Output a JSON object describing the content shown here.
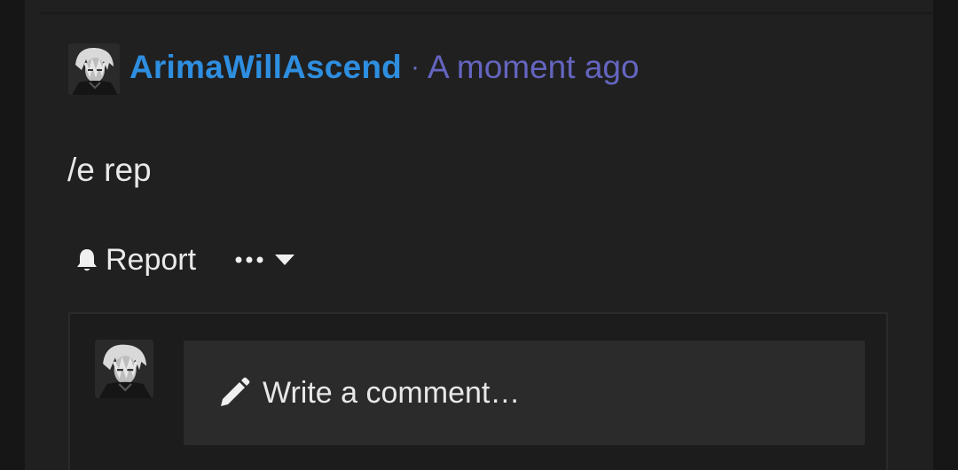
{
  "post": {
    "author": "ArimaWillAscend",
    "separator": "·",
    "timestamp": "A moment ago",
    "body": "/e rep",
    "avatar_icon": "user-avatar"
  },
  "actions": {
    "report_label": "Report",
    "report_icon": "bell-icon",
    "more_icon": "ellipsis-icon",
    "more_caret_icon": "caret-down-icon"
  },
  "comment_box": {
    "placeholder": "Write a comment…",
    "icon": "pencil-icon",
    "avatar_icon": "user-avatar"
  },
  "colors": {
    "background": "#161616",
    "card": "#202020",
    "username": "#2e8ee0",
    "timestamp": "#6465c0",
    "text": "#e8e8e8",
    "input_bg": "#2b2b2b"
  }
}
